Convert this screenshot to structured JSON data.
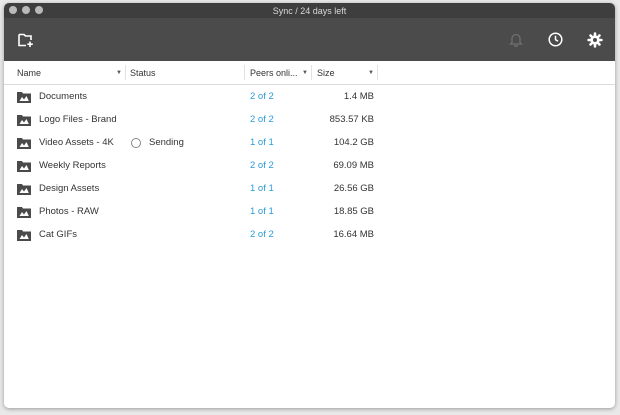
{
  "window": {
    "title": "Sync / 24 days left"
  },
  "toolbar": {
    "add_folder_icon": "folder-add-icon",
    "notifications_icon": "bell-icon",
    "history_icon": "clock-icon",
    "settings_icon": "gear-icon"
  },
  "table": {
    "headers": {
      "name": "Name",
      "status": "Status",
      "peers": "Peers onli...",
      "size": "Size"
    },
    "rows": [
      {
        "name": "Documents",
        "status": "",
        "peers": "2 of 2",
        "size": "1.4 MB"
      },
      {
        "name": "Logo Files - Brand",
        "status": "",
        "peers": "2 of 2",
        "size": "853.57 KB"
      },
      {
        "name": "Video Assets - 4K",
        "status": "Sending",
        "peers": "1 of 1",
        "size": "104.2 GB"
      },
      {
        "name": "Weekly Reports",
        "status": "",
        "peers": "2 of 2",
        "size": "69.09 MB"
      },
      {
        "name": "Design Assets",
        "status": "",
        "peers": "1 of 1",
        "size": "26.56 GB"
      },
      {
        "name": "Photos - RAW",
        "status": "",
        "peers": "1 of 1",
        "size": "18.85 GB"
      },
      {
        "name": "Cat GIFs",
        "status": "",
        "peers": "2 of 2",
        "size": "16.64 MB"
      }
    ]
  },
  "colors": {
    "toolbar": "#4b4b4b",
    "titlebar": "#3e3e3e",
    "link": "#2a9bd8"
  }
}
